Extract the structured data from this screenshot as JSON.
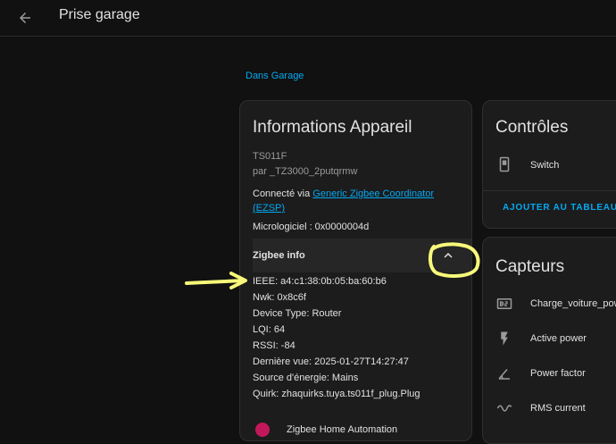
{
  "header": {
    "title": "Prise garage"
  },
  "area_link": "Dans Garage",
  "device_info": {
    "title": "Informations Appareil",
    "model": "TS011F",
    "manufacturer": "par _TZ3000_2putqrmw",
    "connected_prefix": "Connecté via",
    "connected_link": "Generic Zigbee Coordinator (EZSP)",
    "firmware": "Micrologiciel : 0x0000004d",
    "zigbee_section_title": "Zigbee info",
    "zigbee_fields": [
      "IEEE: a4:c1:38:0b:05:ba:60:b6",
      "Nwk: 0x8c6f",
      "Device Type: Router",
      "LQI: 64",
      "RSSI: -84",
      "Dernière vue: 2025-01-27T14:27:47",
      "Source d'énergie: Mains",
      "Quirk: zhaquirks.tuya.ts011f_plug.Plug"
    ],
    "bottom_row_text": "Zigbee Home Automation"
  },
  "controls": {
    "title": "Contrôles",
    "switch_label": "Switch",
    "add_dashboard": "AJOUTER AU TABLEAU DE BORD"
  },
  "sensors": {
    "title": "Capteurs",
    "items": [
      {
        "label": "Charge_voiture_power",
        "icon": "counter-icon"
      },
      {
        "label": "Active power",
        "icon": "flash-icon"
      },
      {
        "label": "Power factor",
        "icon": "angle-icon"
      },
      {
        "label": "RMS current",
        "icon": "current-ac-icon"
      }
    ]
  },
  "colors": {
    "background": "#111111",
    "card": "#1c1c1c",
    "accent": "#03a9f4",
    "annotation": "#f8f87a"
  }
}
